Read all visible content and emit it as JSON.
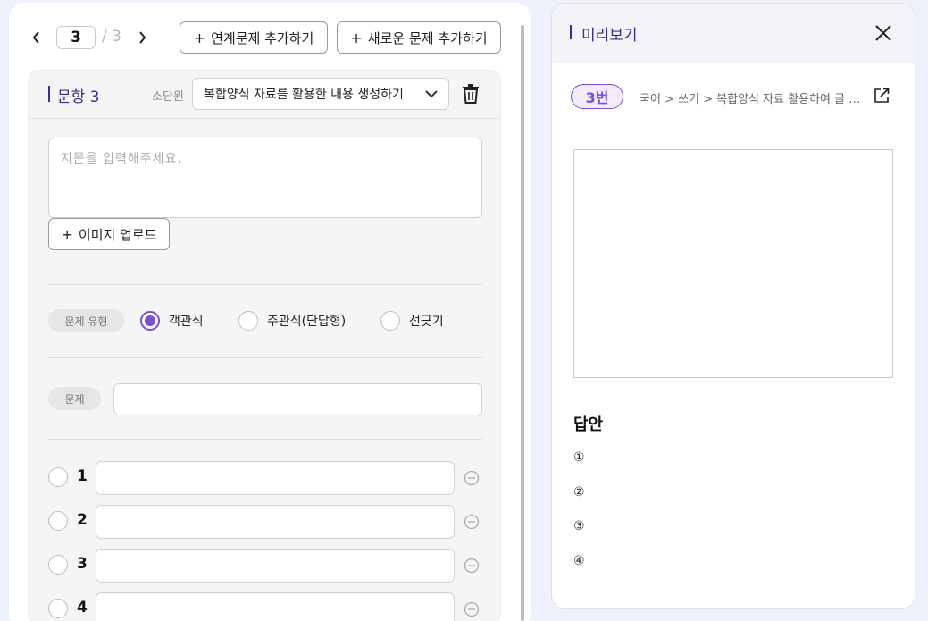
{
  "pagination": {
    "current": "3",
    "total": "/ 3"
  },
  "toolbar": {
    "add_linked": "연계문제 추가하기",
    "add_new": "새로운 문제 추가하기",
    "plus": "+"
  },
  "question": {
    "title": "문항 3",
    "subunit_label": "소단원",
    "subunit_value": "복합양식 자료를 활용한 내용 생성하기",
    "passage_placeholder": "지문을 입력해주세요.",
    "upload_label": "이미지 업로드",
    "type_label": "문제 유형",
    "types": [
      "객관식",
      "주관식(단답형)",
      "선긋기"
    ],
    "selected_type": "객관식",
    "question_label": "문제",
    "choices": [
      "1",
      "2",
      "3",
      "4"
    ]
  },
  "preview": {
    "title": "미리보기",
    "number_badge": "3번",
    "breadcrumb": "국어 > 쓰기 > 복합양식 자료 활용하여 글 쓰기",
    "answer_title": "답안",
    "answer_marks": [
      "①",
      "②",
      "③",
      "④"
    ]
  },
  "colors": {
    "accent": "#7b4dd9",
    "title": "#3c2d8c",
    "background": "#eef0fa"
  }
}
